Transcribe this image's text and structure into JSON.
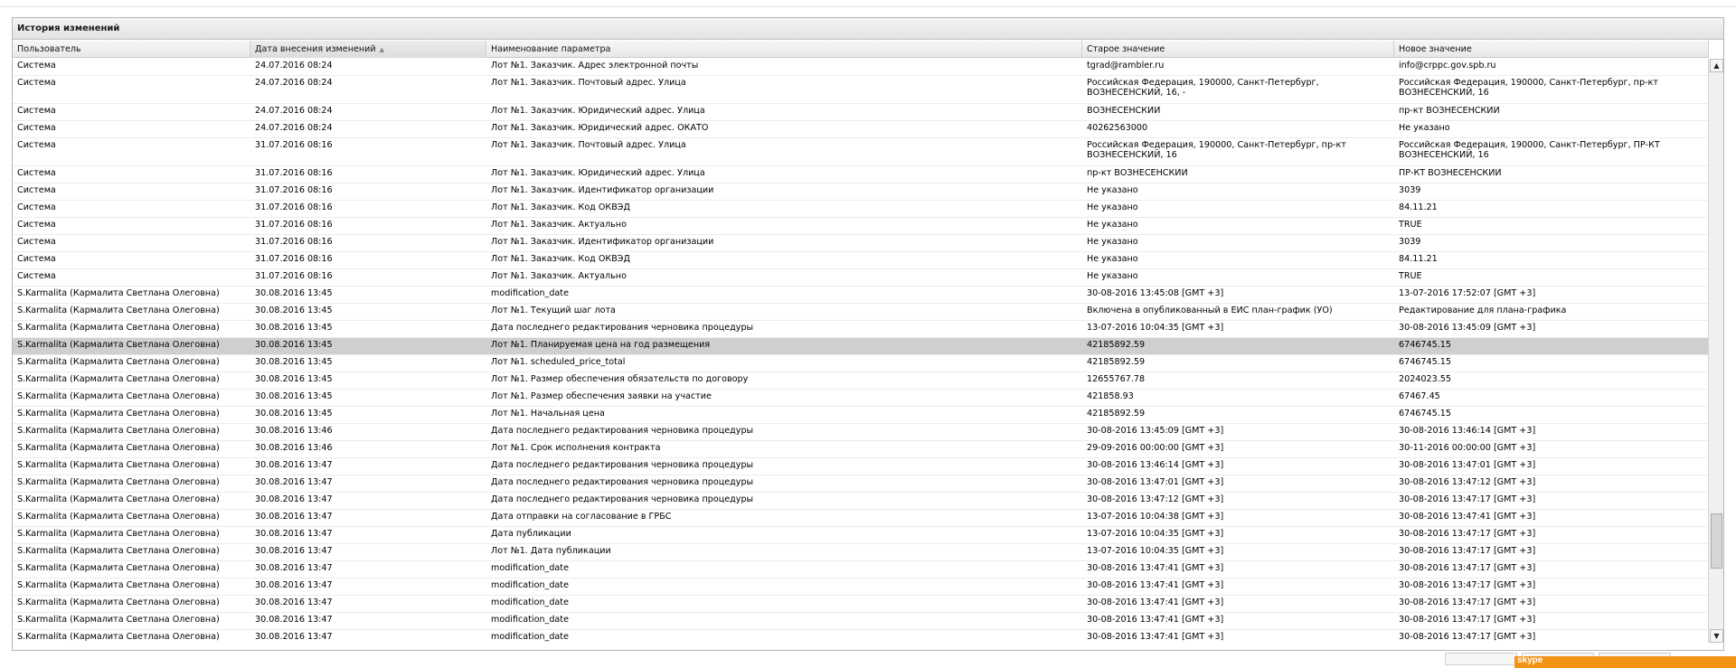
{
  "panel": {
    "title": "История изменений"
  },
  "columns": [
    "Пользователь",
    "Дата внесения изменений",
    "Наименование параметра",
    "Старое значение",
    "Новое значение"
  ],
  "rows": [
    [
      "Система",
      "24.07.2016 08:24",
      "Лот №1. Заказчик. Адрес электронной почты",
      "tgrad@rambler.ru",
      "info@crppc.gov.spb.ru"
    ],
    [
      "Система",
      "24.07.2016 08:24",
      "Лот №1. Заказчик. Почтовый адрес. Улица",
      "Российская Федерация, 190000, Санкт-Петербург, ВОЗНЕСЕНСКИЙ, 16, -",
      "Российская Федерация, 190000, Санкт-Петербург, пр-кт ВОЗНЕСЕНСКИЙ, 16"
    ],
    [
      "Система",
      "24.07.2016 08:24",
      "Лот №1. Заказчик. Юридический адрес. Улица",
      "ВОЗНЕСЕНСКИЙ",
      "пр-кт ВОЗНЕСЕНСКИЙ"
    ],
    [
      "Система",
      "24.07.2016 08:24",
      "Лот №1. Заказчик. Юридический адрес. ОКАТО",
      "40262563000",
      "Не указано"
    ],
    [
      "Система",
      "31.07.2016 08:16",
      "Лот №1. Заказчик. Почтовый адрес. Улица",
      "Российская Федерация, 190000, Санкт-Петербург, пр-кт ВОЗНЕСЕНСКИЙ, 16",
      "Российская Федерация, 190000, Санкт-Петербург, ПР-КТ ВОЗНЕСЕНСКИЙ, 16"
    ],
    [
      "Система",
      "31.07.2016 08:16",
      "Лот №1. Заказчик. Юридический адрес. Улица",
      "пр-кт ВОЗНЕСЕНСКИЙ",
      "ПР-КТ ВОЗНЕСЕНСКИЙ"
    ],
    [
      "Система",
      "31.07.2016 08:16",
      "Лот №1. Заказчик. Идентификатор организации",
      "Не указано",
      "3039"
    ],
    [
      "Система",
      "31.07.2016 08:16",
      "Лот №1. Заказчик. Код ОКВЭД",
      "Не указано",
      "84.11.21"
    ],
    [
      "Система",
      "31.07.2016 08:16",
      "Лот №1. Заказчик. Актуально",
      "Не указано",
      "TRUE"
    ],
    [
      "Система",
      "31.07.2016 08:16",
      "Лот №1. Заказчик. Идентификатор организации",
      "Не указано",
      "3039"
    ],
    [
      "Система",
      "31.07.2016 08:16",
      "Лот №1. Заказчик. Код ОКВЭД",
      "Не указано",
      "84.11.21"
    ],
    [
      "Система",
      "31.07.2016 08:16",
      "Лот №1. Заказчик. Актуально",
      "Не указано",
      "TRUE"
    ],
    [
      "S.Karmalita (Кармалита Светлана Олеговна)",
      "30.08.2016 13:45",
      "modification_date",
      "30-08-2016 13:45:08 [GMT +3]",
      "13-07-2016 17:52:07 [GMT +3]"
    ],
    [
      "S.Karmalita (Кармалита Светлана Олеговна)",
      "30.08.2016 13:45",
      "Лот №1. Текущий шаг лота",
      "Включена в опубликованный в ЕИС план-график (УО)",
      "Редактирование для плана-графика"
    ],
    [
      "S.Karmalita (Кармалита Светлана Олеговна)",
      "30.08.2016 13:45",
      "Дата последнего редактирования черновика процедуры",
      "13-07-2016 10:04:35 [GMT +3]",
      "30-08-2016 13:45:09 [GMT +3]"
    ],
    [
      "S.Karmalita (Кармалита Светлана Олеговна)",
      "30.08.2016 13:45",
      "Лот №1. Планируемая цена на год размещения",
      "42185892.59",
      "6746745.15"
    ],
    [
      "S.Karmalita (Кармалита Светлана Олеговна)",
      "30.08.2016 13:45",
      "Лот №1. scheduled_price_total",
      "42185892.59",
      "6746745.15"
    ],
    [
      "S.Karmalita (Кармалита Светлана Олеговна)",
      "30.08.2016 13:45",
      "Лот №1. Размер обеспечения обязательств по договору",
      "12655767.78",
      "2024023.55"
    ],
    [
      "S.Karmalita (Кармалита Светлана Олеговна)",
      "30.08.2016 13:45",
      "Лот №1. Размер обеспечения заявки на участие",
      "421858.93",
      "67467.45"
    ],
    [
      "S.Karmalita (Кармалита Светлана Олеговна)",
      "30.08.2016 13:45",
      "Лот №1. Начальная цена",
      "42185892.59",
      "6746745.15"
    ],
    [
      "S.Karmalita (Кармалита Светлана Олеговна)",
      "30.08.2016 13:46",
      "Дата последнего редактирования черновика процедуры",
      "30-08-2016 13:45:09 [GMT +3]",
      "30-08-2016 13:46:14 [GMT +3]"
    ],
    [
      "S.Karmalita (Кармалита Светлана Олеговна)",
      "30.08.2016 13:46",
      "Лот №1. Срок исполнения контракта",
      "29-09-2016 00:00:00 [GMT +3]",
      "30-11-2016 00:00:00 [GMT +3]"
    ],
    [
      "S.Karmalita (Кармалита Светлана Олеговна)",
      "30.08.2016 13:47",
      "Дата последнего редактирования черновика процедуры",
      "30-08-2016 13:46:14 [GMT +3]",
      "30-08-2016 13:47:01 [GMT +3]"
    ],
    [
      "S.Karmalita (Кармалита Светлана Олеговна)",
      "30.08.2016 13:47",
      "Дата последнего редактирования черновика процедуры",
      "30-08-2016 13:47:01 [GMT +3]",
      "30-08-2016 13:47:12 [GMT +3]"
    ],
    [
      "S.Karmalita (Кармалита Светлана Олеговна)",
      "30.08.2016 13:47",
      "Дата последнего редактирования черновика процедуры",
      "30-08-2016 13:47:12 [GMT +3]",
      "30-08-2016 13:47:17 [GMT +3]"
    ],
    [
      "S.Karmalita (Кармалита Светлана Олеговна)",
      "30.08.2016 13:47",
      "Дата отправки на согласование в ГРБС",
      "13-07-2016 10:04:38 [GMT +3]",
      "30-08-2016 13:47:41 [GMT +3]"
    ],
    [
      "S.Karmalita (Кармалита Светлана Олеговна)",
      "30.08.2016 13:47",
      "Дата публикации",
      "13-07-2016 10:04:35 [GMT +3]",
      "30-08-2016 13:47:17 [GMT +3]"
    ],
    [
      "S.Karmalita (Кармалита Светлана Олеговна)",
      "30.08.2016 13:47",
      "Лот №1. Дата публикации",
      "13-07-2016 10:04:35 [GMT +3]",
      "30-08-2016 13:47:17 [GMT +3]"
    ],
    [
      "S.Karmalita (Кармалита Светлана Олеговна)",
      "30.08.2016 13:47",
      "modification_date",
      "30-08-2016 13:47:41 [GMT +3]",
      "30-08-2016 13:47:17 [GMT +3]"
    ],
    [
      "S.Karmalita (Кармалита Светлана Олеговна)",
      "30.08.2016 13:47",
      "modification_date",
      "30-08-2016 13:47:41 [GMT +3]",
      "30-08-2016 13:47:17 [GMT +3]"
    ],
    [
      "S.Karmalita (Кармалита Светлана Олеговна)",
      "30.08.2016 13:47",
      "modification_date",
      "30-08-2016 13:47:41 [GMT +3]",
      "30-08-2016 13:47:17 [GMT +3]"
    ],
    [
      "S.Karmalita (Кармалита Светлана Олеговна)",
      "30.08.2016 13:47",
      "modification_date",
      "30-08-2016 13:47:41 [GMT +3]",
      "30-08-2016 13:47:17 [GMT +3]"
    ],
    [
      "S.Karmalita (Кармалита Светлана Олеговна)",
      "30.08.2016 13:47",
      "modification_date",
      "30-08-2016 13:47:41 [GMT +3]",
      "30-08-2016 13:47:17 [GMT +3]"
    ]
  ],
  "selected_row": 15,
  "sorted_column": 1,
  "scroll": {
    "position_fraction": 0.88,
    "visible_fraction": 0.1
  },
  "footer": {
    "orange_label": "skype"
  },
  "colors": {
    "selected_row": "#cfcfcf",
    "accent": "#f39316"
  }
}
